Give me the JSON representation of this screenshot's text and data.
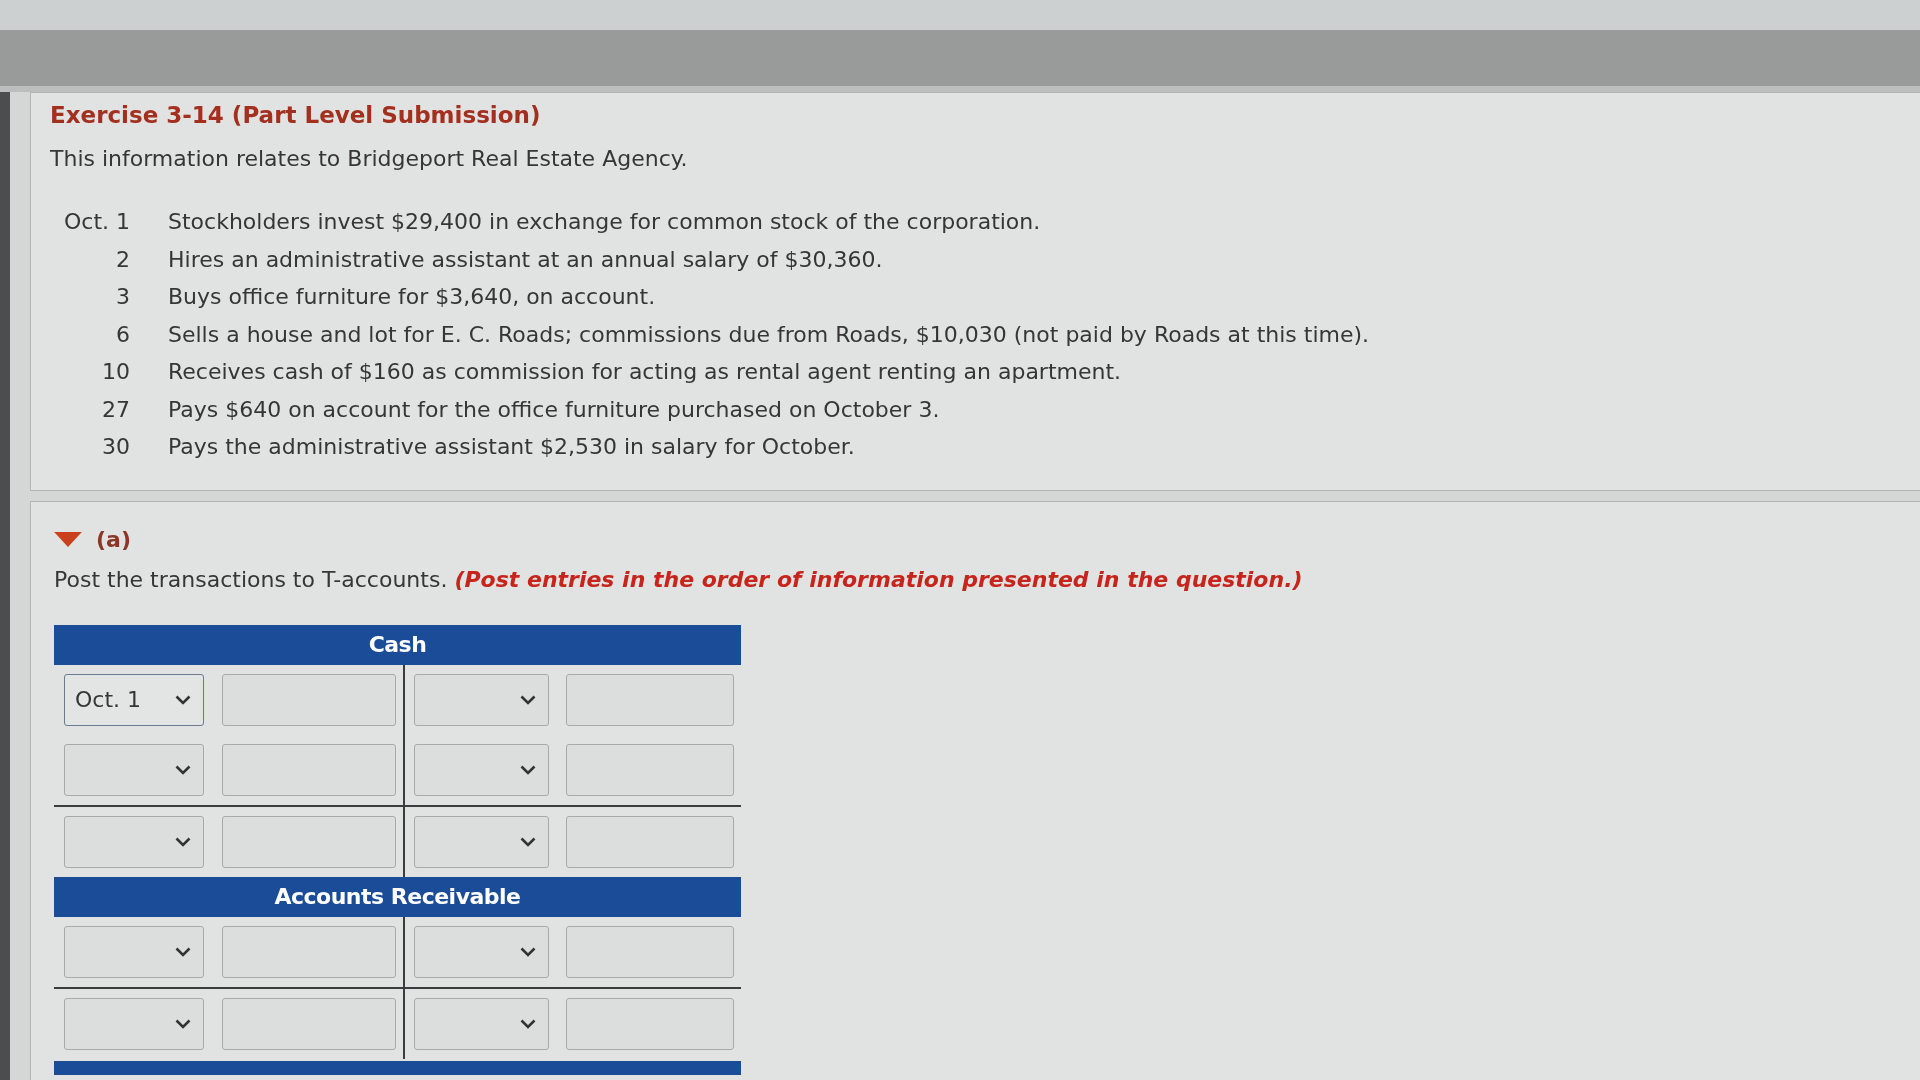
{
  "exercise": {
    "title": "Exercise 3-14 (Part Level Submission)",
    "intro": "This information relates to Bridgeport Real Estate Agency."
  },
  "transactions": [
    {
      "date": "Oct. 1",
      "text": "Stockholders invest $29,400 in exchange for common stock of the corporation."
    },
    {
      "date": "2",
      "text": "Hires an administrative assistant at an annual salary of $30,360."
    },
    {
      "date": "3",
      "text": "Buys office furniture for $3,640, on account."
    },
    {
      "date": "6",
      "text": "Sells a house and lot for E. C. Roads; commissions due from Roads, $10,030 (not paid by Roads at this time)."
    },
    {
      "date": "10",
      "text": "Receives cash of $160 as commission for acting as rental agent renting an apartment."
    },
    {
      "date": "27",
      "text": "Pays $640 on account for the office furniture purchased on October 3."
    },
    {
      "date": "30",
      "text": "Pays the administrative assistant $2,530 in salary for October."
    }
  ],
  "part": {
    "label": "(a)",
    "expanded": true,
    "instruction": "Post the transactions to T-accounts. *(Post entries in the order of information presented in the question.)*"
  },
  "t_accounts": [
    {
      "kind": "account",
      "title": "Cash",
      "rows": [
        {
          "kind": "entry",
          "left_date": "Oct. 1"
        },
        {
          "kind": "entry"
        },
        {
          "kind": "balance"
        }
      ]
    },
    {
      "kind": "account",
      "title": "Accounts Receivable",
      "rows": [
        {
          "kind": "entry"
        },
        {
          "kind": "balance"
        }
      ]
    },
    {
      "kind": "cut_off"
    }
  ]
}
